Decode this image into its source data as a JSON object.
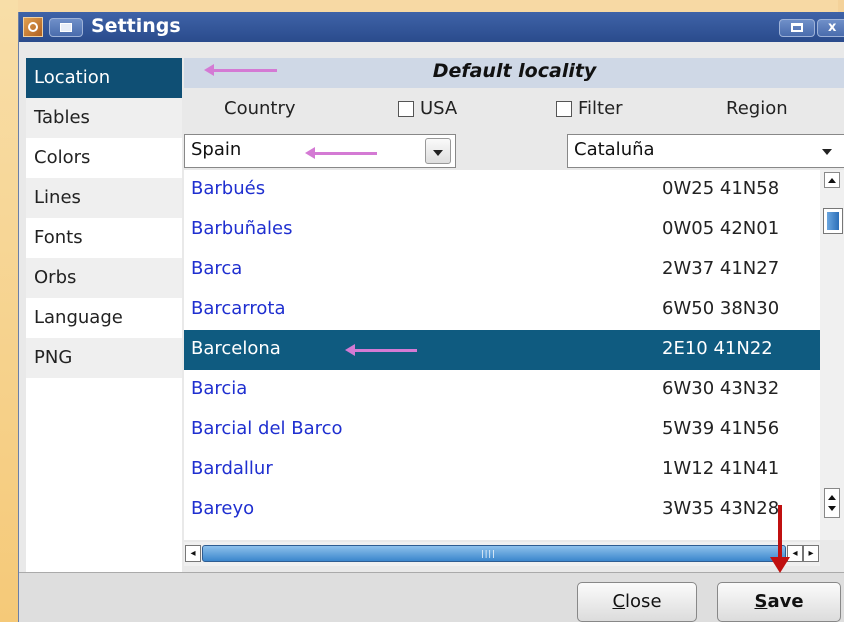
{
  "window": {
    "title": "Settings",
    "close_glyph": "x"
  },
  "sidebar": {
    "items": [
      {
        "label": "Location"
      },
      {
        "label": "Tables"
      },
      {
        "label": "Colors"
      },
      {
        "label": "Lines"
      },
      {
        "label": "Fonts"
      },
      {
        "label": "Orbs"
      },
      {
        "label": "Language"
      },
      {
        "label": "PNG"
      }
    ],
    "selected": "Location"
  },
  "section": {
    "title": "Default locality"
  },
  "filters": {
    "country_label": "Country",
    "usa_label": "USA",
    "filter_label": "Filter",
    "region_label": "Region",
    "country_value": "Spain",
    "region_value": "Cataluña"
  },
  "locations": [
    {
      "name": "Barbués",
      "coords": "0W25 41N58"
    },
    {
      "name": "Barbuñales",
      "coords": "0W05 42N01"
    },
    {
      "name": "Barca",
      "coords": "2W37 41N27"
    },
    {
      "name": "Barcarrota",
      "coords": "6W50 38N30"
    },
    {
      "name": "Barcelona",
      "coords": "2E10 41N22",
      "selected": true
    },
    {
      "name": "Barcia",
      "coords": "6W30 43N32"
    },
    {
      "name": "Barcial del Barco",
      "coords": "5W39 41N56"
    },
    {
      "name": "Bardallur",
      "coords": "1W12 41N41"
    },
    {
      "name": "Bareyo",
      "coords": "3W35 43N28"
    }
  ],
  "buttons": {
    "close": {
      "mnemonic": "C",
      "rest": "lose"
    },
    "save": {
      "mnemonic": "S",
      "rest": "ave"
    }
  },
  "colors": {
    "selection": "#0f5b80",
    "link_text": "#1f2fd0",
    "annotation_pink": "#d47ad4",
    "annotation_red": "#c01010"
  }
}
